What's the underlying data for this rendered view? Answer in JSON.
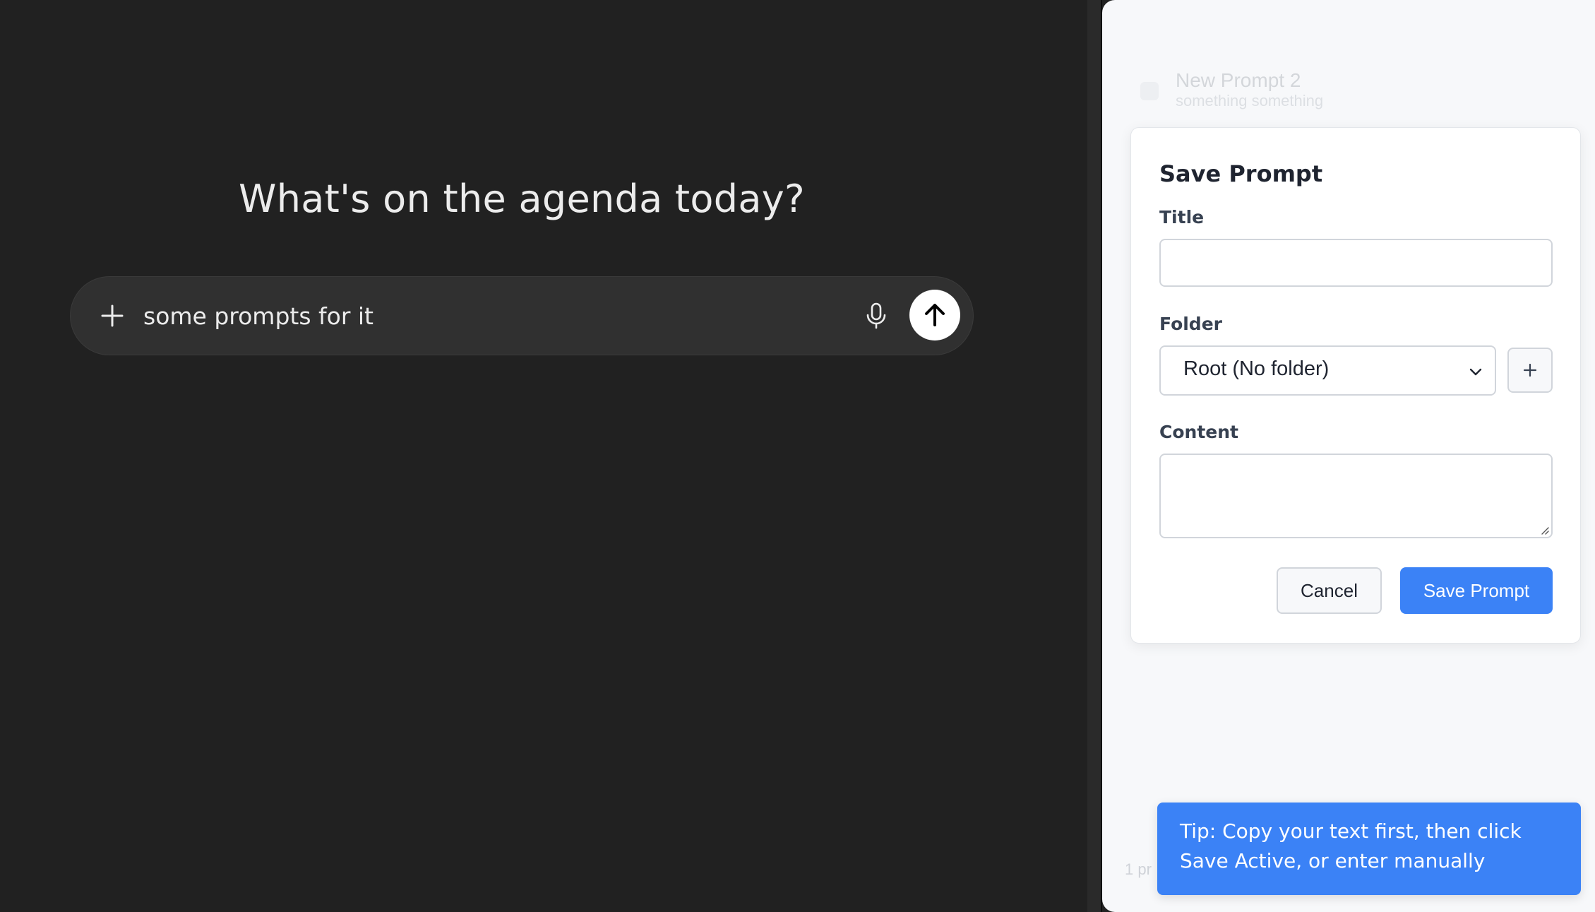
{
  "main": {
    "headline": "What's on the agenda today?",
    "composer": {
      "value": "some prompts for it",
      "add_icon": "plus-icon",
      "mic_icon": "microphone-icon",
      "send_icon": "arrow-up-icon"
    }
  },
  "panel": {
    "background_item": {
      "title": "New Prompt 2",
      "subtitle": "something something"
    },
    "footer_fragment": "1 pr",
    "dialog": {
      "title": "Save Prompt",
      "title_label": "Title",
      "title_value": "",
      "folder_label": "Folder",
      "folder_selected": "Root (No folder)",
      "add_folder_icon": "plus-icon",
      "content_label": "Content",
      "content_value": "",
      "cancel_label": "Cancel",
      "save_label": "Save Prompt"
    },
    "tip": "Tip: Copy your text first, then click Save Active, or enter manually"
  },
  "colors": {
    "main_bg": "#212121",
    "composer_bg": "#303030",
    "panel_bg": "#f7f8fa",
    "accent": "#3b82f6"
  }
}
